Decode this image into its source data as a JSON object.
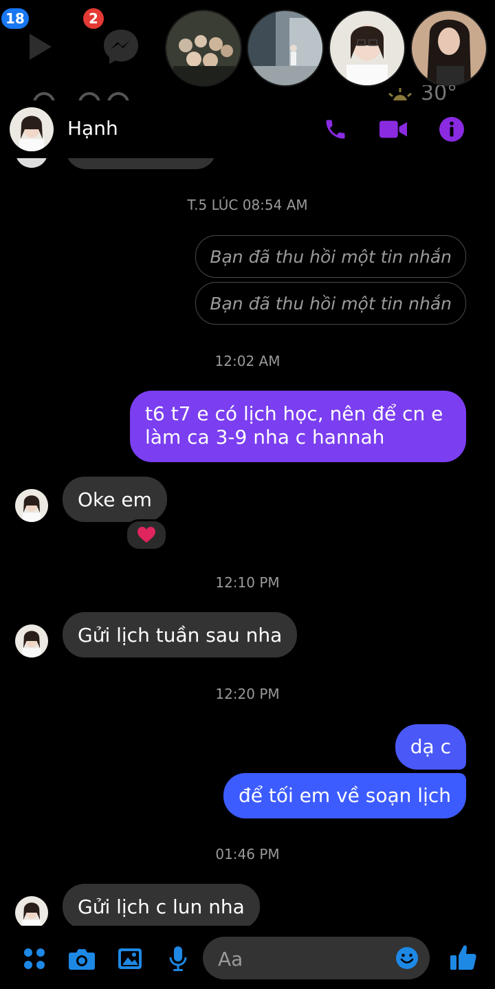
{
  "chat_heads": {
    "video_badge": "18",
    "messenger_badge": "2",
    "weather_fragment": "30°"
  },
  "header": {
    "contact_name": "Hạnh"
  },
  "messages": {
    "ts1": "T.5 LÚC 08:54 AM",
    "recalled1": "Bạn đã thu hồi một tin nhắn",
    "recalled2": "Bạn đã thu hồi một tin nhắn",
    "ts2": "12:02 AM",
    "out1_line1": "t6 t7 e có lịch học, nên để cn e",
    "out1_line2": "làm ca 3-9 nha c hannah",
    "in1": "Oke em",
    "ts3": "12:10 PM",
    "in2": "Gửi lịch tuần sau nha",
    "ts4": "12:20 PM",
    "out2": "dạ c",
    "out3": "để tối em về soạn lịch",
    "ts5": "01:46 PM",
    "in3": "Gửi lịch c lun nha"
  },
  "composer": {
    "placeholder": "Aa"
  },
  "colors": {
    "accent": "#8a2be2",
    "bubble_purple": "#7b3ef0",
    "bubble_blue": "#3d5cff",
    "bubble_incoming": "#333333",
    "badge_blue": "#1877f2",
    "badge_red": "#e53935",
    "composer_blue": "#1e88e5"
  }
}
